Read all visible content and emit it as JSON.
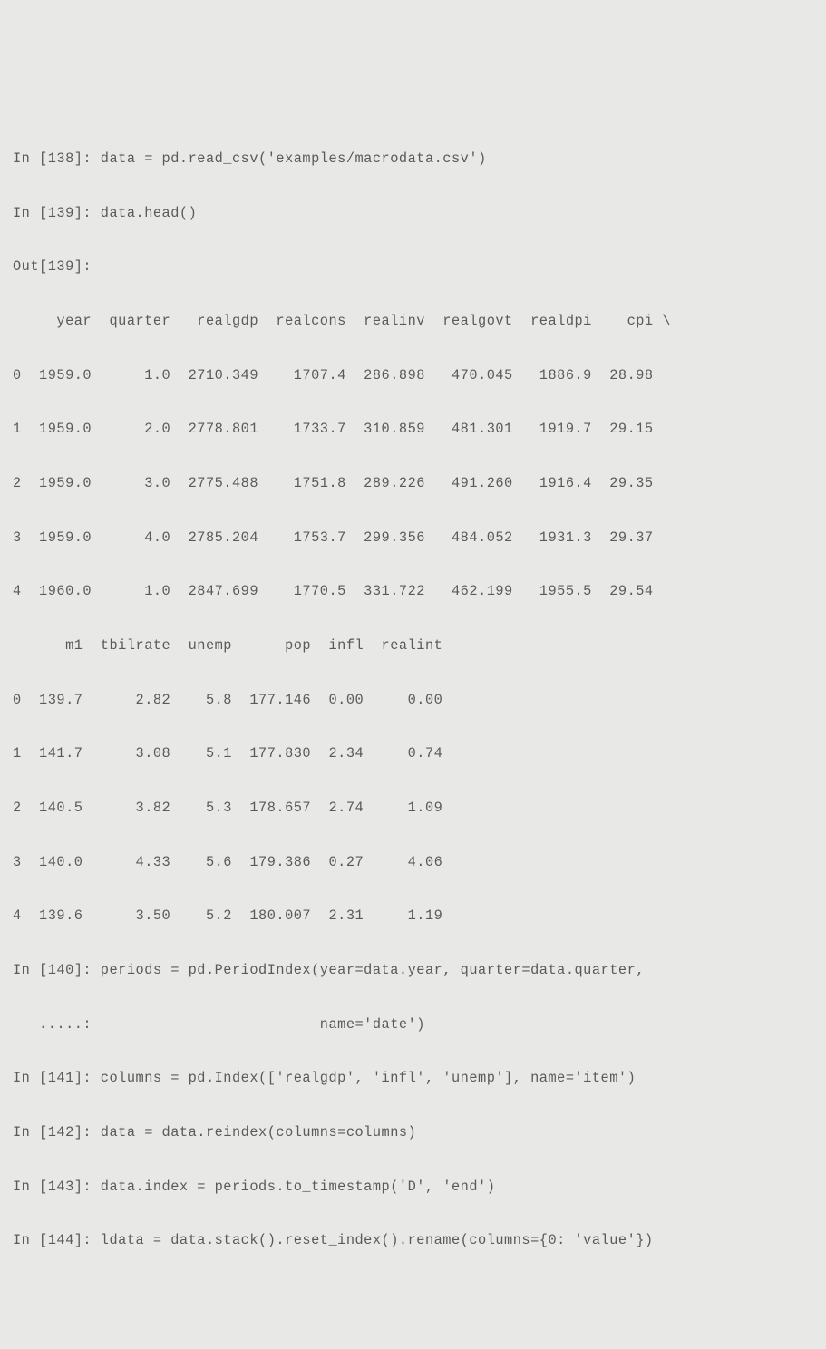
{
  "lines": [
    "In [138]: data = pd.read_csv('examples/macrodata.csv')",
    "In [139]: data.head()",
    "Out[139]:",
    "     year  quarter   realgdp  realcons  realinv  realgovt  realdpi    cpi \\",
    "0  1959.0      1.0  2710.349    1707.4  286.898   470.045   1886.9  28.98",
    "1  1959.0      2.0  2778.801    1733.7  310.859   481.301   1919.7  29.15",
    "2  1959.0      3.0  2775.488    1751.8  289.226   491.260   1916.4  29.35",
    "3  1959.0      4.0  2785.204    1753.7  299.356   484.052   1931.3  29.37",
    "4  1960.0      1.0  2847.699    1770.5  331.722   462.199   1955.5  29.54",
    "      m1  tbilrate  unemp      pop  infl  realint",
    "0  139.7      2.82    5.8  177.146  0.00     0.00",
    "1  141.7      3.08    5.1  177.830  2.34     0.74",
    "2  140.5      3.82    5.3  178.657  2.74     1.09",
    "3  140.0      4.33    5.6  179.386  0.27     4.06",
    "4  139.6      3.50    5.2  180.007  2.31     1.19",
    "In [140]: periods = pd.PeriodIndex(year=data.year, quarter=data.quarter,",
    "   .....:                          name='date')",
    "In [141]: columns = pd.Index(['realgdp', 'infl', 'unemp'], name='item')",
    "In [142]: data = data.reindex(columns=columns)",
    "In [143]: data.index = periods.to_timestamp('D', 'end')",
    "In [144]: ldata = data.stack().reset_index().rename(columns={0: 'value'})"
  ]
}
